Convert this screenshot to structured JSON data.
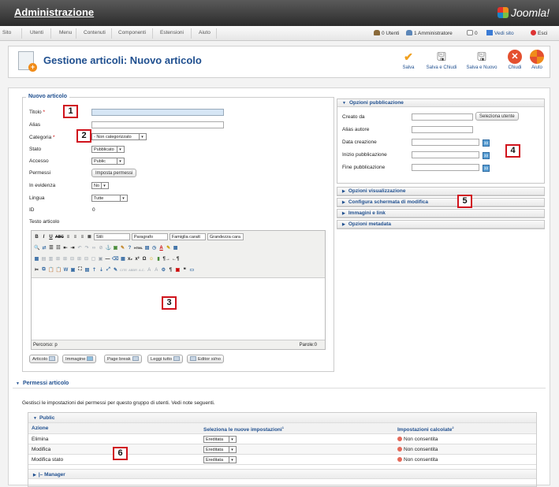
{
  "header": {
    "title": "Administrazione",
    "logo_text": "Joomla!"
  },
  "menubar": {
    "items": [
      "Sito",
      "Utenti",
      "Menu",
      "Contenuti",
      "Componenti",
      "Estensioni",
      "Aiuto"
    ],
    "status": {
      "users": "0 Utenti",
      "admins": "1 Amministratore",
      "messages": "0",
      "view_site": "Vedi sito",
      "logout": "Esci"
    }
  },
  "toolbar": {
    "title": "Gestione articoli: Nuovo articolo",
    "buttons": [
      "Salva",
      "Salva e Chiudi",
      "Salva e Nuovo",
      "Chiudi",
      "Aiuto"
    ]
  },
  "form": {
    "legend": "Nuovo articolo",
    "labels": {
      "title": "Titolo",
      "alias": "Alias",
      "category": "Categoria",
      "state": "Stato",
      "access": "Accesso",
      "permissions": "Permessi",
      "featured": "In evidenza",
      "language": "Lingua",
      "id": "ID",
      "text": "Testo articolo"
    },
    "required_mark": "*",
    "values": {
      "title": "",
      "alias": "",
      "category": "- Non categorizzato",
      "state": "Pubblicato",
      "access": "Public",
      "featured": "No",
      "language": "Tutte",
      "id": "0"
    },
    "permissions_button": "Imposta permessi"
  },
  "editor": {
    "dropdowns": [
      "Stili",
      "Paragrafo",
      "Famiglia caratt",
      "Grandezza cara"
    ],
    "path": "Percorso: p",
    "word_count": "Parole:0",
    "buttons": [
      "Articolo",
      "Immagine",
      "Page break",
      "Leggi tutto",
      "Editor si/no"
    ]
  },
  "sidebar": {
    "publishing": {
      "title": "Opzioni pubblicazione",
      "labels": [
        "Creato da",
        "Alias autore",
        "Data creazione",
        "Inizio pubblicazione",
        "Fine pubblicazione"
      ],
      "select_user": "Seleziona utente",
      "calendar_label": "33"
    },
    "sections": [
      "Opzioni visualizzazione",
      "Configura schermata di modifica",
      "Immagini e link",
      "Opzioni metadata"
    ]
  },
  "permissions": {
    "title": "Permessi articolo",
    "description": "Gestisci le impostazioni dei permessi per questo gruppo di utenti. Vedi note seguenti.",
    "group": "Public",
    "columns": [
      "Azione",
      "Seleziona le nuove impostazioni",
      "Impostazioni calcolate"
    ],
    "column_notes": [
      "",
      "1",
      "2"
    ],
    "rows": [
      {
        "action": "Elimina",
        "setting": "Ereditata",
        "calculated": "Non consentita"
      },
      {
        "action": "Modifica",
        "setting": "Ereditata",
        "calculated": "Non consentita"
      },
      {
        "action": "Modifica stato",
        "setting": "Ereditata",
        "calculated": "Non consentita"
      }
    ],
    "next_group": "|– Manager"
  },
  "callouts": [
    "1",
    "2",
    "3",
    "4",
    "5",
    "6"
  ],
  "colors": {
    "title_blue": "#1f4f8f",
    "callout_red": "#d0121c",
    "header_dark": "#2c2c2c",
    "title_field": "#d6e6f5"
  }
}
